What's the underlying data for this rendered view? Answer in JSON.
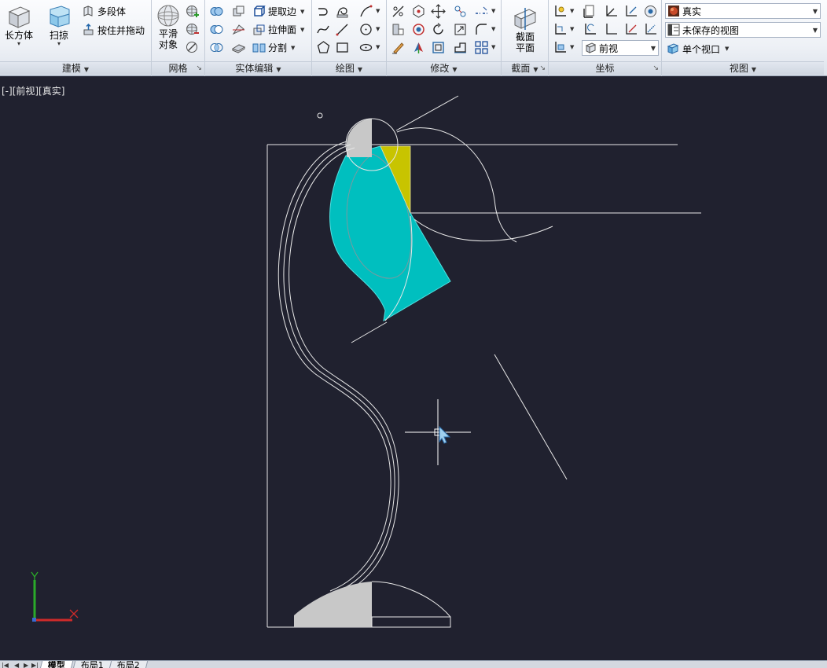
{
  "ribbon": {
    "modeling": {
      "title": "建模",
      "box": "长方体",
      "sweep": "扫掠",
      "polysolid": "多段体",
      "presspull": "按住并拖动"
    },
    "mesh": {
      "title": "网格",
      "smooth_line1": "平滑",
      "smooth_line2": "对象"
    },
    "solid_edit": {
      "title": "实体编辑",
      "extract_edges": "提取边",
      "extrude_faces": "拉伸面",
      "separate": "分割"
    },
    "draw": {
      "title": "绘图"
    },
    "modify": {
      "title": "修改"
    },
    "section": {
      "title": "截面",
      "plane_line1": "截面",
      "plane_line2": "平面"
    },
    "ucs": {
      "title": "坐标",
      "named_view": "前视"
    },
    "view": {
      "title": "视图",
      "visual_style": "真实",
      "saved_view": "未保存的视图",
      "viewport_config": "单个视口"
    }
  },
  "viewport": {
    "label": "[-][前视][真实]"
  },
  "tabs": [
    "模型",
    "布局1",
    "布局2"
  ]
}
